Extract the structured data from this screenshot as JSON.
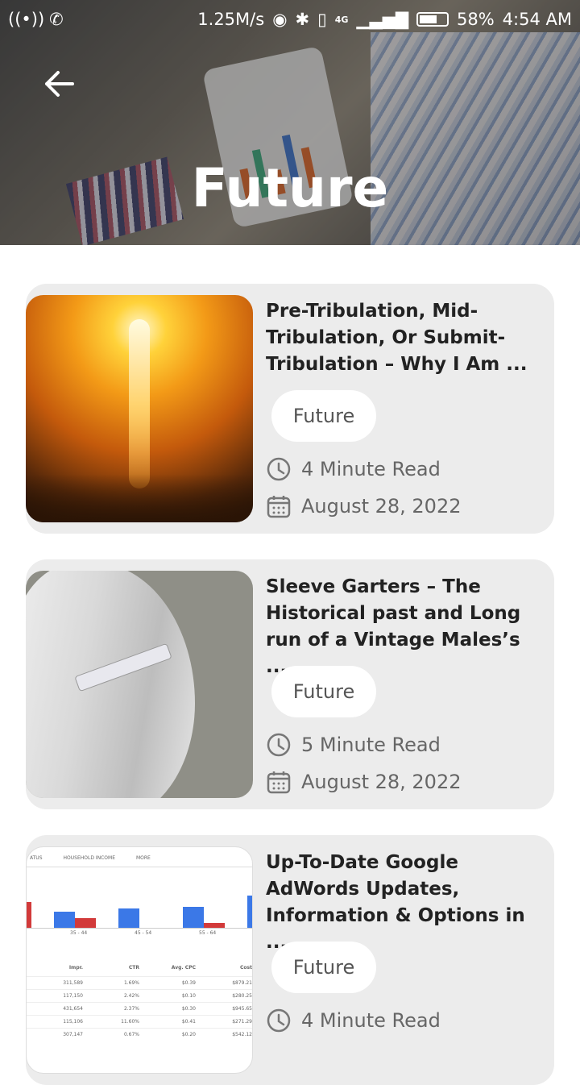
{
  "status_bar": {
    "speed": "1.25M/s",
    "network": "4G",
    "battery": "58%",
    "battery_level": 0.58,
    "time": "4:54 AM"
  },
  "header": {
    "title": "Future"
  },
  "articles": [
    {
      "title": "Pre-Tribulation, Mid-Tribulation, Or Submit-Tribulation – Why I Am ...",
      "category": "Future",
      "read_time": "4 Minute Read",
      "date": "August 28, 2022",
      "image": "explosion-over-city"
    },
    {
      "title": "Sleeve Garters – The Historical past and Long run of a Vintage Males’s ...",
      "category": "Future",
      "read_time": "5 Minute Read",
      "date": "August 28, 2022",
      "image": "sleeve-garter-on-shirt"
    },
    {
      "title": "Up-To-Date Google AdWords Updates, Information & Options in ...",
      "category": "Future",
      "read_time": "4 Minute Read",
      "date": "",
      "image": "adwords-report-screenshot",
      "thumb_text": {
        "tab1": "ATUS",
        "tab2": "HOUSEHOLD INCOME",
        "tab3": "MORE",
        "axis1": "35 - 44",
        "axis2": "45 - 54",
        "axis3": "55 - 64",
        "col1": "Impr.",
        "col2": "CTR",
        "col3": "Avg. CPC",
        "col4": "Cost",
        "rows": [
          [
            "311,589",
            "1.69%",
            "$0.39",
            "$879.21"
          ],
          [
            "117,150",
            "2.42%",
            "$0.10",
            "$280.25"
          ],
          [
            "431,654",
            "2.37%",
            "$0.30",
            "$945.65"
          ],
          [
            "115,106",
            "11.60%",
            "$0.41",
            "$271.29"
          ],
          [
            "307,147",
            "0.67%",
            "$0.20",
            "$542.12"
          ]
        ]
      }
    }
  ]
}
